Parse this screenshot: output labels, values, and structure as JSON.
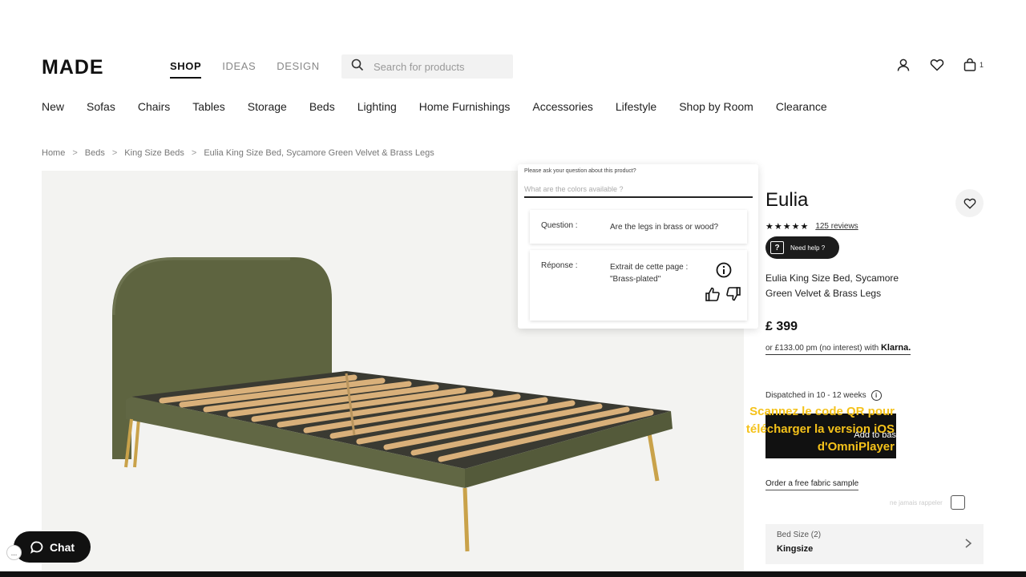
{
  "brand": {
    "logo": "MADE"
  },
  "top_nav": {
    "shop": "SHOP",
    "ideas": "IDEAS",
    "design": "DESIGN"
  },
  "search": {
    "placeholder": "Search for products"
  },
  "header": {
    "basket_count": "1"
  },
  "categories": [
    "New",
    "Sofas",
    "Chairs",
    "Tables",
    "Storage",
    "Beds",
    "Lighting",
    "Home Furnishings",
    "Accessories",
    "Lifestyle",
    "Shop by Room",
    "Clearance"
  ],
  "breadcrumb": [
    "Home",
    "Beds",
    "King Size Beds",
    "Eulia King Size Bed, Sycamore Green Velvet & Brass Legs"
  ],
  "qa_popup": {
    "prompt": "Please ask your question about this product?",
    "input_placeholder": "What are the colors available ?",
    "question_label": "Question :",
    "question_text": "Are the legs in brass or wood?",
    "answer_label": "Réponse :",
    "answer_text": "Extrait de cette page : \"Brass-plated\""
  },
  "product": {
    "title": "Eulia",
    "stars": "★★★★★",
    "reviews": "125 reviews",
    "help_label": "Need help ?",
    "description": "Eulia King Size Bed, Sycamore Green Velvet & Brass Legs",
    "price": "£ 399",
    "klarna_text": "or £133.00 pm (no interest) with",
    "klarna_brand": "Klarna.",
    "dispatch": "Dispatched in 10 - 12 weeks",
    "add_button": "Add to bas",
    "fabric_sample": "Order a free fabric sample",
    "remember_label": "ne jamais rappeler",
    "bed_size_label": "Bed Size (2)",
    "bed_size_value": "Kingsize"
  },
  "overlay": {
    "qr_text": "Scannez le code QR pour télécharger la version iOS d'OmniPlayer"
  },
  "chat": {
    "label": "Chat",
    "dots": "..."
  },
  "colors": {
    "accent": "#111111",
    "velvet_green": "#5e6440",
    "brass": "#c9a24a",
    "overlay_yellow": "#f5c21a"
  }
}
